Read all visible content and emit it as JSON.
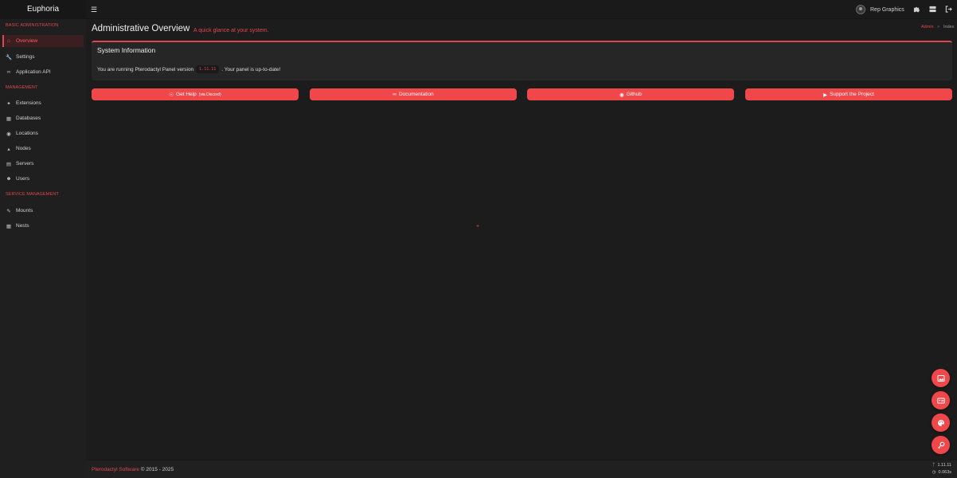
{
  "app": {
    "brand": "Euphoria"
  },
  "header": {
    "menu_icon": "menu-icon",
    "user_name": "Rep Graphics",
    "icons": [
      "puzzle-icon",
      "server-icon",
      "logout-icon"
    ]
  },
  "sidebar": {
    "sections": [
      {
        "title": "BASIC ADMINISTRATION"
      },
      {
        "title": "MANAGEMENT"
      },
      {
        "title": "SERVICE MANAGEMENT"
      }
    ],
    "items": [
      {
        "label": "Overview",
        "icon": "home-icon",
        "active": true
      },
      {
        "label": "Settings",
        "icon": "wrench-icon"
      },
      {
        "label": "Application API",
        "icon": "link-icon"
      },
      {
        "label": "Extensions",
        "icon": "puzzle-icon"
      },
      {
        "label": "Databases",
        "icon": "database-icon"
      },
      {
        "label": "Locations",
        "icon": "globe-icon"
      },
      {
        "label": "Nodes",
        "icon": "sitemap-icon"
      },
      {
        "label": "Servers",
        "icon": "server-icon"
      },
      {
        "label": "Users",
        "icon": "users-icon"
      },
      {
        "label": "Mounts",
        "icon": "pencil-icon"
      },
      {
        "label": "Nests",
        "icon": "grid-icon"
      }
    ]
  },
  "page": {
    "title": "Administrative Overview",
    "subtitle": "A quick glance at your system.",
    "breadcrumb": {
      "root": "Admin",
      "separator": ">",
      "current": "Index"
    }
  },
  "system_info": {
    "title": "System Information",
    "text_before": "You are running Pterodactyl Panel version",
    "version": "1.11.11",
    "text_after": ". Your panel is up-to-date!"
  },
  "buttons": [
    {
      "label": "Get Help",
      "small": "(via Discord)",
      "icon": "life-ring-icon"
    },
    {
      "label": "Documentation",
      "small": "",
      "icon": "link-icon"
    },
    {
      "label": "Github",
      "small": "",
      "icon": "github-icon"
    },
    {
      "label": "Support the Project",
      "small": "",
      "icon": "youtube-icon"
    }
  ],
  "fabs": [
    "image-icon",
    "id-card-icon",
    "palette-icon",
    "key-icon"
  ],
  "footer": {
    "link": "Pterodactyl Software",
    "copyright": "© 2015 - 2025",
    "version": "1.11.11",
    "time": "0.063s"
  },
  "colors": {
    "accent": "#f0474b",
    "background": "#1c1c1c",
    "sidebar": "#1f1f1f"
  }
}
